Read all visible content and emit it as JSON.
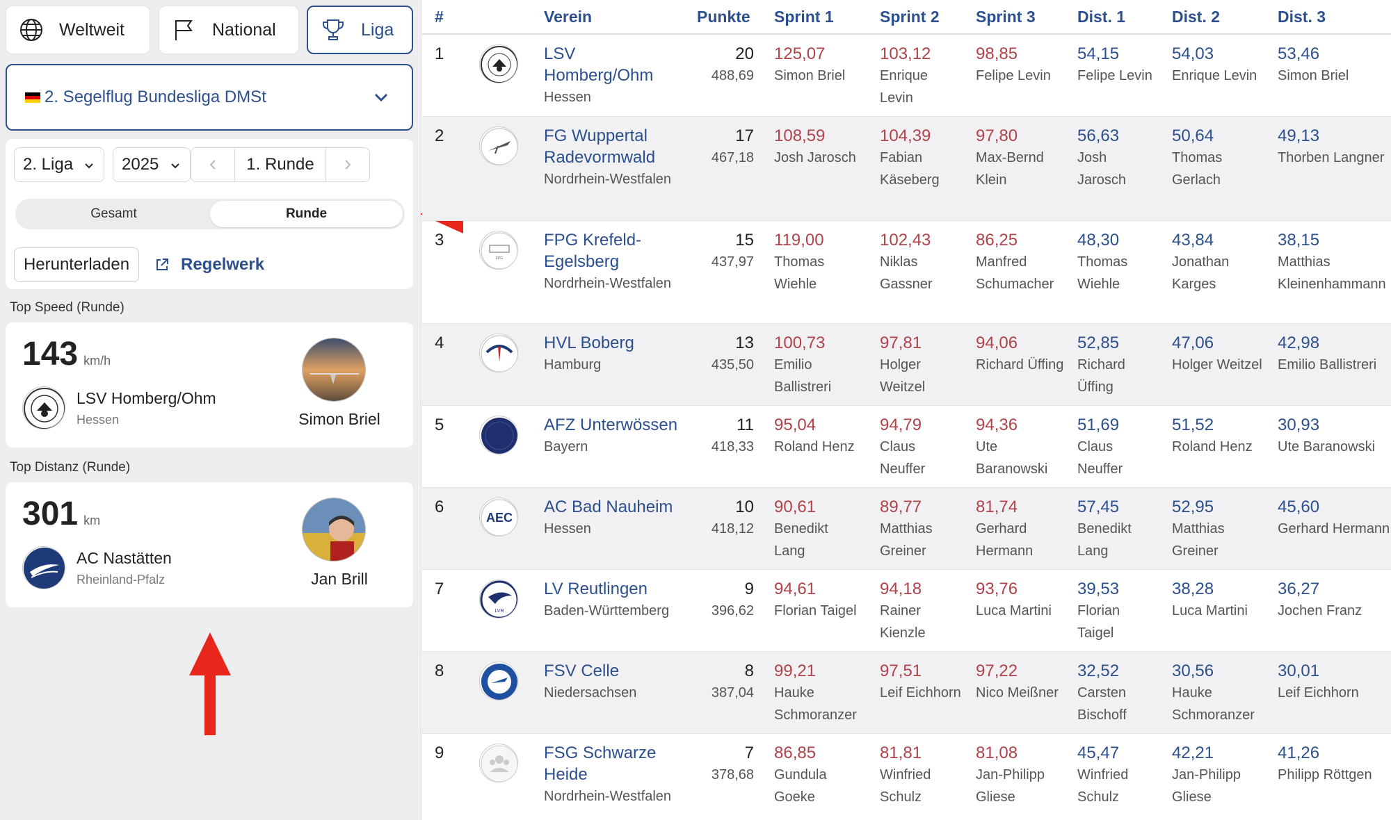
{
  "scope_tabs": {
    "worldwide": "Weltweit",
    "national": "National",
    "league": "Liga"
  },
  "league_select": {
    "value": "2. Segelflug Bundesliga DMSt",
    "flag": "germany"
  },
  "filters": {
    "league_level": "2. Liga",
    "year": "2025",
    "round": "1. Runde",
    "segment_total": "Gesamt",
    "segment_round": "Runde",
    "segment_selected": "Runde",
    "download": "Herunterladen",
    "rules": "Regelwerk"
  },
  "top_speed": {
    "title": "Top Speed (Runde)",
    "value": "143",
    "unit": "km/h",
    "club": "LSV Homberg/Ohm",
    "region": "Hessen",
    "pilot": "Simon Briel"
  },
  "top_distance": {
    "title": "Top Distanz (Runde)",
    "value": "301",
    "unit": "km",
    "club": "AC Nastätten",
    "region": "Rheinland-Pfalz",
    "pilot": "Jan Brill"
  },
  "table": {
    "headers": {
      "rank": "#",
      "club": "Verein",
      "points": "Punkte",
      "sprint1": "Sprint 1",
      "sprint2": "Sprint 2",
      "sprint3": "Sprint 3",
      "dist1": "Dist. 1",
      "dist2": "Dist. 2",
      "dist3": "Dist. 3"
    },
    "rows": [
      {
        "rank": "1",
        "club": "LSV Homberg/Ohm",
        "region": "Hessen",
        "points": "20",
        "score": "488,69",
        "s1": "125,07",
        "s1p": "Simon Briel",
        "s2": "103,12",
        "s2p": "Enrique Levin",
        "s3": "98,85",
        "s3p": "Felipe Levin",
        "d1": "54,15",
        "d1p": "Felipe Levin",
        "d2": "54,03",
        "d2p": "Enrique Levin",
        "d3": "53,46",
        "d3p": "Simon Briel"
      },
      {
        "rank": "2",
        "club": "FG Wuppertal Radevormwald",
        "region": "Nordrhein-Westfalen",
        "points": "17",
        "score": "467,18",
        "s1": "108,59",
        "s1p": "Josh Jarosch",
        "s2": "104,39",
        "s2p": "Fabian Käseberg",
        "s3": "97,80",
        "s3p": "Max-Bernd Klein",
        "d1": "56,63",
        "d1p": "Josh Jarosch",
        "d2": "50,64",
        "d2p": "Thomas Gerlach",
        "d3": "49,13",
        "d3p": "Thorben Langner"
      },
      {
        "rank": "3",
        "club": "FPG Krefeld-Egelsberg",
        "region": "Nordrhein-Westfalen",
        "points": "15",
        "score": "437,97",
        "s1": "119,00",
        "s1p": "Thomas Wiehle",
        "s2": "102,43",
        "s2p": "Niklas Gassner",
        "s3": "86,25",
        "s3p": "Manfred Schumacher",
        "d1": "48,30",
        "d1p": "Thomas Wiehle",
        "d2": "43,84",
        "d2p": "Jonathan Karges",
        "d3": "38,15",
        "d3p": "Matthias Kleinenhammann"
      },
      {
        "rank": "4",
        "club": "HVL Boberg",
        "region": "Hamburg",
        "points": "13",
        "score": "435,50",
        "s1": "100,73",
        "s1p": "Emilio Ballistreri",
        "s2": "97,81",
        "s2p": "Holger Weitzel",
        "s3": "94,06",
        "s3p": "Richard Üffing",
        "d1": "52,85",
        "d1p": "Richard Üffing",
        "d2": "47,06",
        "d2p": "Holger Weitzel",
        "d3": "42,98",
        "d3p": "Emilio Ballistreri"
      },
      {
        "rank": "5",
        "club": "AFZ Unterwössen",
        "region": "Bayern",
        "points": "11",
        "score": "418,33",
        "s1": "95,04",
        "s1p": "Roland Henz",
        "s2": "94,79",
        "s2p": "Claus Neuffer",
        "s3": "94,36",
        "s3p": "Ute Baranowski",
        "d1": "51,69",
        "d1p": "Claus Neuffer",
        "d2": "51,52",
        "d2p": "Roland Henz",
        "d3": "30,93",
        "d3p": "Ute Baranowski"
      },
      {
        "rank": "6",
        "club": "AC Bad Nauheim",
        "region": "Hessen",
        "points": "10",
        "score": "418,12",
        "s1": "90,61",
        "s1p": "Benedikt Lang",
        "s2": "89,77",
        "s2p": "Matthias Greiner",
        "s3": "81,74",
        "s3p": "Gerhard Hermann",
        "d1": "57,45",
        "d1p": "Benedikt Lang",
        "d2": "52,95",
        "d2p": "Matthias Greiner",
        "d3": "45,60",
        "d3p": "Gerhard Hermann"
      },
      {
        "rank": "7",
        "club": "LV Reutlingen",
        "region": "Baden-Württemberg",
        "points": "9",
        "score": "396,62",
        "s1": "94,61",
        "s1p": "Florian Taigel",
        "s2": "94,18",
        "s2p": "Rainer Kienzle",
        "s3": "93,76",
        "s3p": "Luca Martini",
        "d1": "39,53",
        "d1p": "Florian Taigel",
        "d2": "38,28",
        "d2p": "Luca Martini",
        "d3": "36,27",
        "d3p": "Jochen Franz"
      },
      {
        "rank": "8",
        "club": "FSV Celle",
        "region": "Niedersachsen",
        "points": "8",
        "score": "387,04",
        "s1": "99,21",
        "s1p": "Hauke Schmoranzer",
        "s2": "97,51",
        "s2p": "Leif Eichhorn",
        "s3": "97,22",
        "s3p": "Nico Meißner",
        "d1": "32,52",
        "d1p": "Carsten Bischoff",
        "d2": "30,56",
        "d2p": "Hauke Schmoranzer",
        "d3": "30,01",
        "d3p": "Leif Eichhorn"
      },
      {
        "rank": "9",
        "club": "FSG Schwarze Heide",
        "region": "Nordrhein-Westfalen",
        "points": "7",
        "score": "378,68",
        "s1": "86,85",
        "s1p": "Gundula Goeke",
        "s2": "81,81",
        "s2p": "Winfried Schulz",
        "s3": "81,08",
        "s3p": "Jan-Philipp Gliese",
        "d1": "45,47",
        "d1p": "Winfried Schulz",
        "d2": "42,21",
        "d2p": "Jan-Philipp Gliese",
        "d3": "41,26",
        "d3p": "Philipp Röttgen"
      }
    ]
  },
  "colors": {
    "accent": "#2c4f8e",
    "sprint_value": "#b0424a",
    "row_alt": "#f1f1f3",
    "annotation_arrow": "#e8261c"
  },
  "icons": {
    "worldwide": "globe-icon",
    "national": "flag-icon",
    "league": "trophy-icon",
    "rules": "external-link-icon"
  }
}
